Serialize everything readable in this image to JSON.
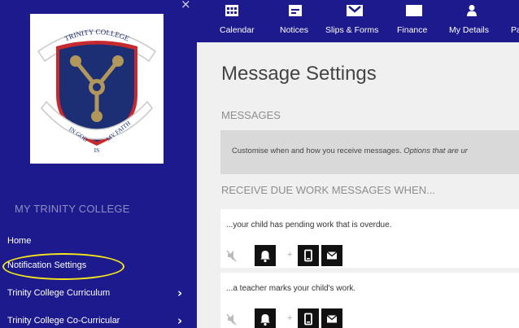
{
  "app": {
    "close_icon": "close-icon",
    "close_glyph": "×"
  },
  "logo": {
    "text_top": "TRINITY COLLEGE",
    "text_bottom_left": "IN GOD",
    "text_bottom_center": "IS",
    "text_bottom_right": "MY FAITH",
    "colors": {
      "shield": "#1d2f74",
      "emblem": "#b1975a",
      "border": "#c8c8c8",
      "ribbon": "#ffffff"
    }
  },
  "sidebar": {
    "heading": "MY TRINITY COLLEGE",
    "items": [
      {
        "label": "Home",
        "has_chevron": false
      },
      {
        "label": "Notification Settings",
        "has_chevron": false,
        "highlighted": true
      },
      {
        "label": "Trinity College Curriculum",
        "has_chevron": true
      },
      {
        "label": "Trinity College Co-Curricular",
        "has_chevron": true
      }
    ],
    "chevron_glyph": "›"
  },
  "topnav": {
    "items": [
      {
        "label": "Calendar",
        "icon": "calendar-icon"
      },
      {
        "label": "Notices",
        "icon": "notices-icon"
      },
      {
        "label": "Slips & Forms",
        "icon": "slips-forms-icon"
      },
      {
        "label": "Finance",
        "icon": "finance-icon"
      },
      {
        "label": "My Details",
        "icon": "person-icon"
      },
      {
        "label": "Pa",
        "icon": ""
      }
    ]
  },
  "main": {
    "title": "Message Settings",
    "messages_heading": "MESSAGES",
    "info_text": "Customise when and how you receive messages. ",
    "info_text_italic": "Options that are ur",
    "due_heading": "RECEIVE DUE WORK MESSAGES WHEN...",
    "rules": [
      {
        "text": "...your child has pending work that is overdue.",
        "plus": "+"
      },
      {
        "text": "...a teacher marks your child's work.",
        "plus": "+"
      }
    ],
    "buttons": {
      "mute": "mute-icon",
      "bell": "bell-icon",
      "phone": "phone-icon",
      "mail": "mail-icon"
    }
  },
  "colors": {
    "nav_bg": "#1c1a8c",
    "main_bg": "#f0f0f0",
    "highlight": "#f5e71c",
    "button_bg": "#111111"
  }
}
